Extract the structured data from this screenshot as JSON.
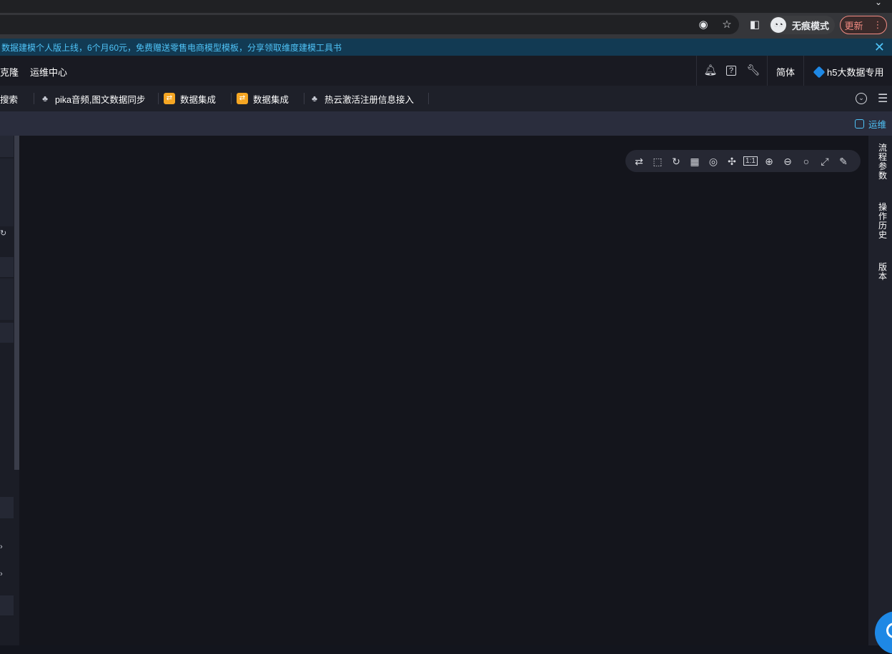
{
  "browser": {
    "incognito_label": "无痕模式",
    "update_label": "更新"
  },
  "notice": {
    "text": "数据建模个人版上线，6个月60元，免费赠送零售电商模型模板，分享领取维度建模工具书"
  },
  "topnav": {
    "items": [
      {
        "label": "克隆"
      },
      {
        "label": "运维中心"
      }
    ],
    "help_badge": "?",
    "language": "简体",
    "project": "h5大数据专用"
  },
  "tabs": [
    {
      "label": "搜索",
      "icon": "search"
    },
    {
      "label": "pika音频,图文数据同步",
      "icon": "flow-icon"
    },
    {
      "label": "数据集成",
      "icon": "sync-icon"
    },
    {
      "label": "数据集成",
      "icon": "sync-icon"
    },
    {
      "label": "热云激活注册信息接入",
      "icon": "flow-icon"
    }
  ],
  "subbar": {
    "ops_label": "运维"
  },
  "canvas_toolbar": [
    "swap-icon",
    "box-select-icon",
    "refresh-icon",
    "grid-layout-icon",
    "center-icon",
    "fit-icon",
    "actual-size-icon",
    "zoom-in-icon",
    "zoom-out-icon",
    "search-icon",
    "fullscreen-icon",
    "format-icon"
  ],
  "right_panel": {
    "items": [
      {
        "label": "流程参数"
      },
      {
        "label": "操作历史"
      },
      {
        "label": "版本"
      }
    ]
  },
  "colors": {
    "accent": "#4fc3f7",
    "canvas_bg": "#14151c",
    "sync_icon": "#f5a623",
    "help_button": "#1e88e5"
  }
}
